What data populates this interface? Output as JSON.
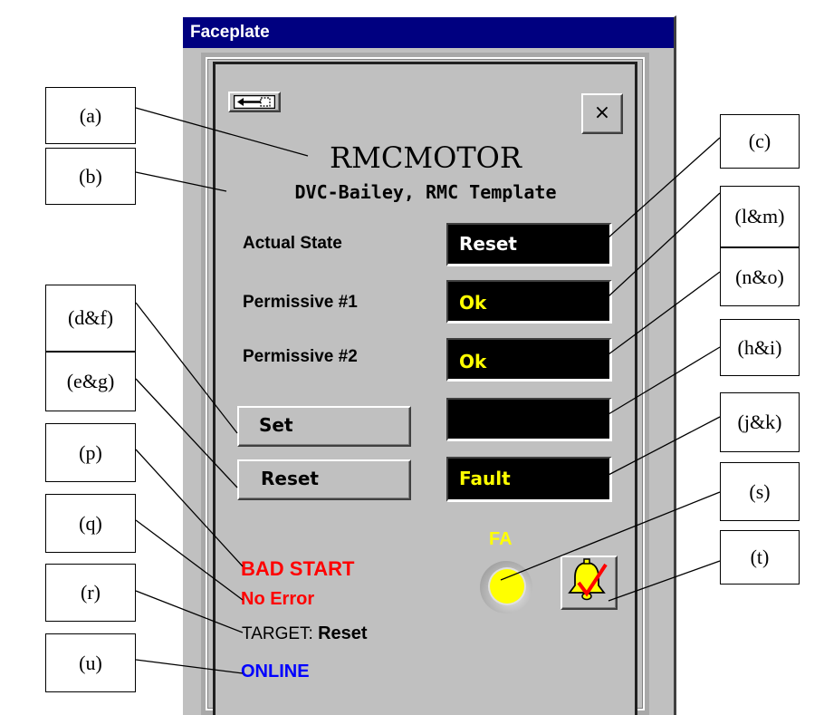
{
  "window": {
    "title": "Faceplate"
  },
  "faceplate": {
    "tag_name": "RMCMOTOR",
    "description": "DVC-Bailey, RMC Template",
    "rows": {
      "actual_state": {
        "label": "Actual State",
        "value": "Reset"
      },
      "permissive_1": {
        "label": "Permissive #1",
        "value": "Ok"
      },
      "permissive_2": {
        "label": "Permissive #2",
        "value": "Ok"
      },
      "set": {
        "button_label": "Set",
        "value": ""
      },
      "reset": {
        "button_label": "Reset",
        "value": "Fault"
      }
    },
    "status": {
      "bad_start": "BAD START",
      "error": "No Error",
      "target_label": "TARGET:",
      "target_value": "Reset",
      "online": "ONLINE"
    },
    "alarm": {
      "label": "FA"
    },
    "icons": {
      "back": "back-arrow-icon",
      "close": "close-icon",
      "acknowledge": "bell-check-icon"
    },
    "close_glyph": "×"
  },
  "callouts": {
    "a": "(a)",
    "b": "(b)",
    "c": "(c)",
    "lm": "(l&m)",
    "no": "(n&o)",
    "df": "(d&f)",
    "eg": "(e&g)",
    "hi": "(h&i)",
    "jk": "(j&k)",
    "p": "(p)",
    "s": "(s)",
    "q": "(q)",
    "t": "(t)",
    "r": "(r)",
    "u": "(u)"
  },
  "colors": {
    "title_bar": "#000080",
    "panel": "#c0c0c0",
    "display_bg": "#000000",
    "display_text_white": "#ffffff",
    "display_text_yellow": "#ffff00",
    "bad_start": "#ff0000",
    "error": "#ff0000",
    "online": "#0000ff",
    "alarm": "#ffff00"
  }
}
